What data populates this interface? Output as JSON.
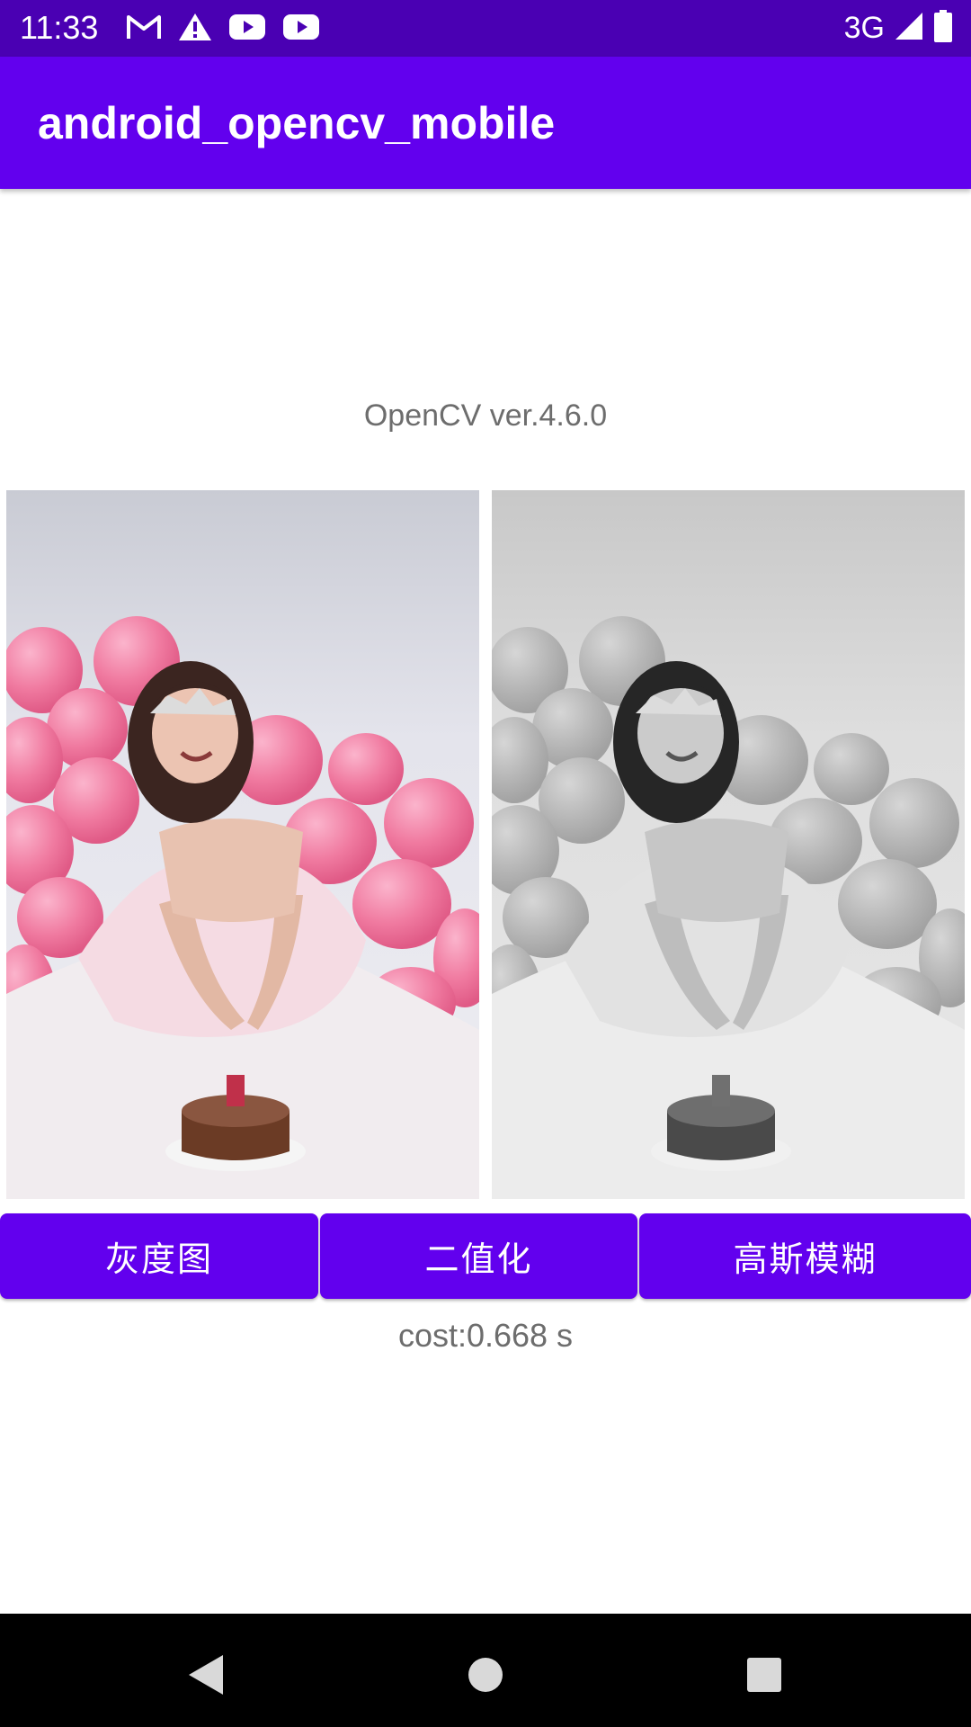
{
  "status_bar": {
    "time": "11:33",
    "network": "3G",
    "icons": [
      "gmail-icon",
      "warning-icon",
      "youtube-icon",
      "youtube-icon",
      "signal-icon",
      "battery-icon"
    ]
  },
  "app_bar": {
    "title": "android_opencv_mobile"
  },
  "main": {
    "version": "OpenCV ver.4.6.0",
    "images": {
      "original": "original-color-photo",
      "processed": "grayscale-photo"
    },
    "buttons": {
      "grayscale": "灰度图",
      "binarize": "二值化",
      "gaussian_blur": "高斯模糊"
    },
    "cost": "cost:0.668 s"
  },
  "nav_bar": {
    "icons": [
      "back-icon",
      "home-icon",
      "recents-icon"
    ]
  },
  "colors": {
    "status_bar": "#4a00b3",
    "app_bar": "#6200ee",
    "button": "#6200ee",
    "text_secondary": "#6d6d6d"
  }
}
